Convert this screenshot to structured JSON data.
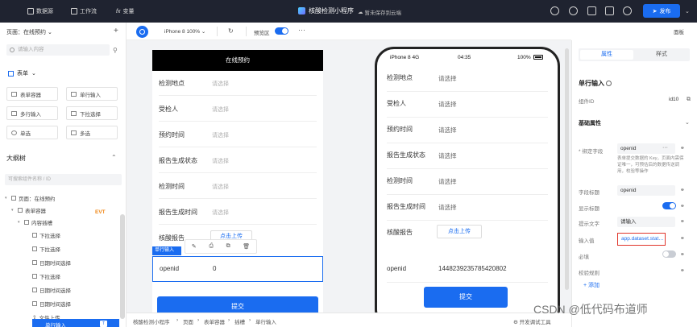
{
  "topbar": {
    "nav": [
      "数据源",
      "工作流",
      "变量"
    ],
    "app_title": "核酸检测小程序",
    "save_status": "暂未保存到云端",
    "publish_label": "发布"
  },
  "left": {
    "page_title": "页面：在线预约",
    "search_placeholder": "请输入内容",
    "section": "表单",
    "components": [
      "表单容器",
      "单行输入",
      "多行输入",
      "下拉选择",
      "单选",
      "多选"
    ],
    "outline_title": "大纲树",
    "outline_search_placeholder": "可搜索组件名称 / ID",
    "evt_badge": "EVT",
    "tree": [
      "页面：在线预约",
      "表单容器",
      "内容插槽",
      "下拉选择",
      "下拉选择",
      "日期时间选择",
      "下拉选择",
      "日期时间选择",
      "日期时间选择",
      "文件上传"
    ],
    "tree_selected": "单行输入",
    "tree_selected_badge": "T"
  },
  "canvas_bar": {
    "device": "iPhone 8 100% ⌄",
    "preview_label": "预览区",
    "panel_label": "面板"
  },
  "form": {
    "header": "在线预约",
    "rows": [
      {
        "label": "检测地点",
        "value": "请选择"
      },
      {
        "label": "受检人",
        "value": "请选择"
      },
      {
        "label": "预约时间",
        "value": "请选择"
      },
      {
        "label": "报告生成状态",
        "value": "请选择"
      },
      {
        "label": "检测时间",
        "value": "请选择"
      },
      {
        "label": "报告生成时间",
        "value": "请选择"
      }
    ],
    "upload_label": "核酸报告",
    "upload_btn": "点击上传",
    "selected_tag": "单行输入",
    "openid_label": "openid",
    "openid_value": "0",
    "submit": "提交"
  },
  "phone": {
    "carrier": "iPhone 8  4G",
    "time": "04:35",
    "battery": "100%",
    "rows": [
      {
        "label": "检测地点",
        "value": "请选择"
      },
      {
        "label": "受检人",
        "value": "请选择"
      },
      {
        "label": "预约时间",
        "value": "请选择"
      },
      {
        "label": "报告生成状态",
        "value": "请选择"
      },
      {
        "label": "检测时间",
        "value": "请选择"
      },
      {
        "label": "报告生成时间",
        "value": "请选择"
      }
    ],
    "upload_label": "核酸报告",
    "upload_btn": "点击上传",
    "openid_label": "openid",
    "openid_value": "1448239235785420802",
    "submit": "提交"
  },
  "breadcrumb": [
    "核酸检测小程序",
    "页面",
    "表单容器",
    "插槽",
    "单行输入"
  ],
  "breadcrumb_tool": "开发调试工具",
  "right": {
    "tabs": [
      "属性",
      "样式"
    ],
    "component_title": "单行输入",
    "component_id_label": "组件ID",
    "component_id_value": "id10",
    "section": "基础属性",
    "bind_label": "* 绑定字段",
    "bind_value": "openid",
    "bind_hint": "表单提交数据的 Key，页面内需保证唯一，可预估后的数据传送调用，校验等操作",
    "field_title_label": "字段标题",
    "field_title_value": "openid",
    "show_title_label": "显示标题",
    "placeholder_label": "提示文字",
    "placeholder_value": "请输入",
    "input_value_label": "输入值",
    "input_value_value": "app.dataset.stat…",
    "required_label": "必填",
    "validation_label": "校验规则",
    "add_label": "+ 添加",
    "accent": "#1a6cf0",
    "highlight": "#e0352b"
  },
  "watermark": "CSDN @低代码布道师"
}
